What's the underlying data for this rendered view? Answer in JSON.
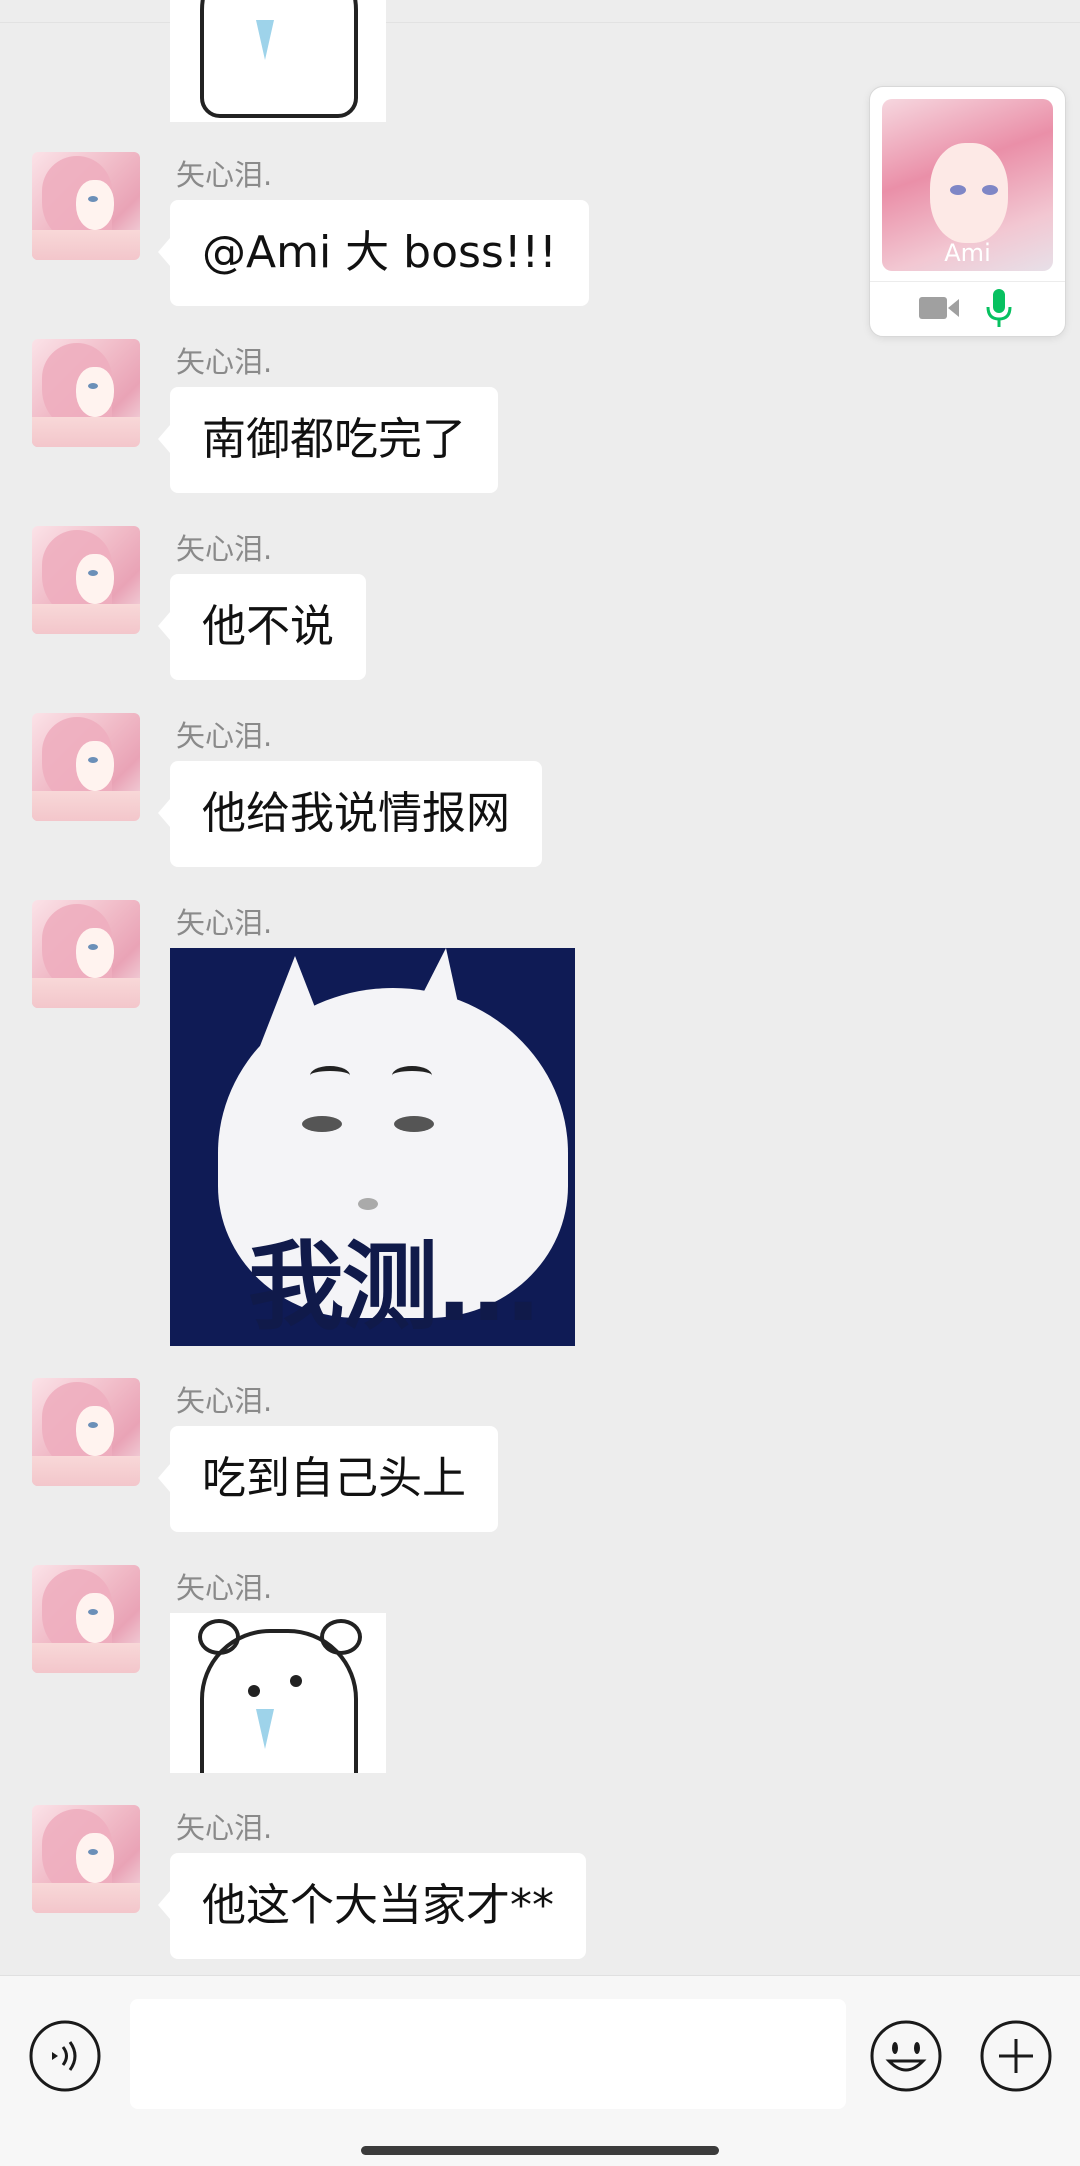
{
  "floating_call": {
    "caller_name": "Ami",
    "camera_color": "#a0a0a0",
    "mic_color": "#07c160"
  },
  "messages": [
    {
      "type": "sticker",
      "sticker": "crying-bear-sticker",
      "partial": true
    },
    {
      "type": "text",
      "sender": "矢心泪.",
      "text": "@Ami  大 boss!!!"
    },
    {
      "type": "text",
      "sender": "矢心泪.",
      "text": "南御都吃完了"
    },
    {
      "type": "text",
      "sender": "矢心泪.",
      "text": "他不说"
    },
    {
      "type": "text",
      "sender": "矢心泪.",
      "text": "他给我说情报网"
    },
    {
      "type": "meme",
      "sender": "矢心泪.",
      "caption": "我测..."
    },
    {
      "type": "text",
      "sender": "矢心泪.",
      "text": "吃到自己头上"
    },
    {
      "type": "sticker",
      "sender": "矢心泪.",
      "sticker": "crying-bear-sticker"
    },
    {
      "type": "text",
      "sender": "矢心泪.",
      "text": "他这个大当家才**"
    }
  ],
  "input_bar": {
    "voice_icon": "voice-icon",
    "emoji_icon": "emoji-icon",
    "plus_icon": "plus-icon",
    "message_value": ""
  },
  "colors": {
    "background": "#ededed",
    "bubble": "#ffffff",
    "sender_name": "#8a8a8a"
  }
}
